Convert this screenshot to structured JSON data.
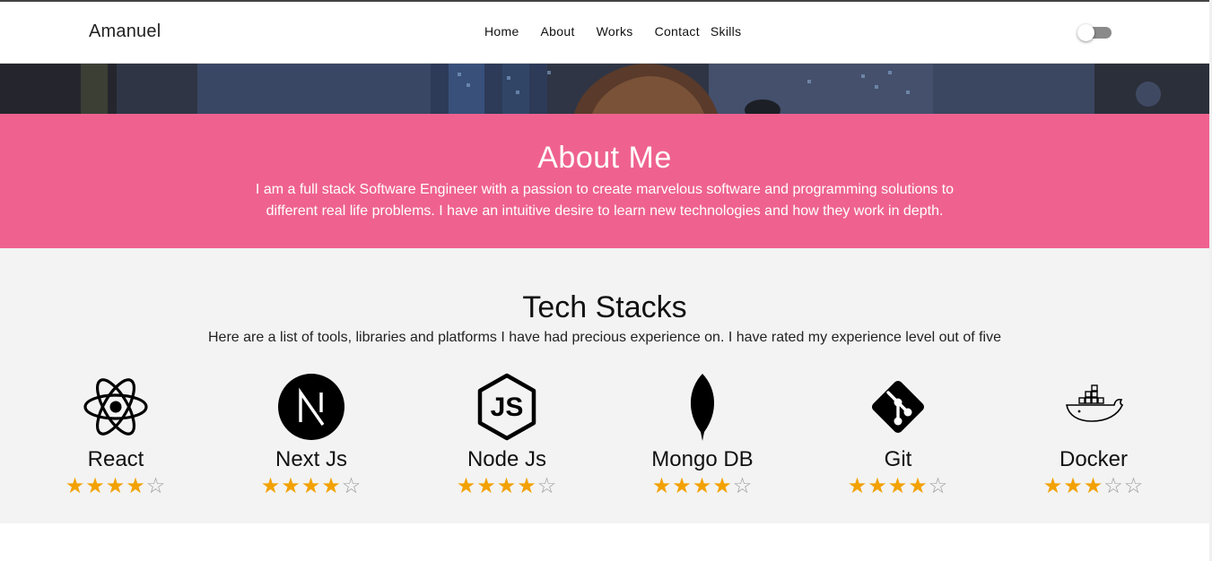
{
  "header": {
    "brand": "Amanuel",
    "nav": [
      "Home",
      "About",
      "Works",
      "Contact",
      "Skills"
    ],
    "theme_toggle": "off"
  },
  "about": {
    "title": "About Me",
    "text": "I am a full stack Software Engineer with a passion to create marvelous software and programming solutions to different real life problems. I have an intuitive desire to learn new technologies and how they work in depth.",
    "background": "#ef6290"
  },
  "tech": {
    "title": "Tech Stacks",
    "subtitle": "Here are a list of tools, libraries and platforms I have had precious experience on. I have rated my experience level out of five",
    "star_color": "#f2a100",
    "items": [
      {
        "name": "React",
        "icon": "react-icon",
        "rating": 4
      },
      {
        "name": "Next Js",
        "icon": "nextjs-icon",
        "rating": 4
      },
      {
        "name": "Node Js",
        "icon": "nodejs-icon",
        "rating": 4
      },
      {
        "name": "Mongo DB",
        "icon": "mongodb-icon",
        "rating": 4
      },
      {
        "name": "Git",
        "icon": "git-icon",
        "rating": 4
      },
      {
        "name": "Docker",
        "icon": "docker-icon",
        "rating": 3
      }
    ]
  }
}
